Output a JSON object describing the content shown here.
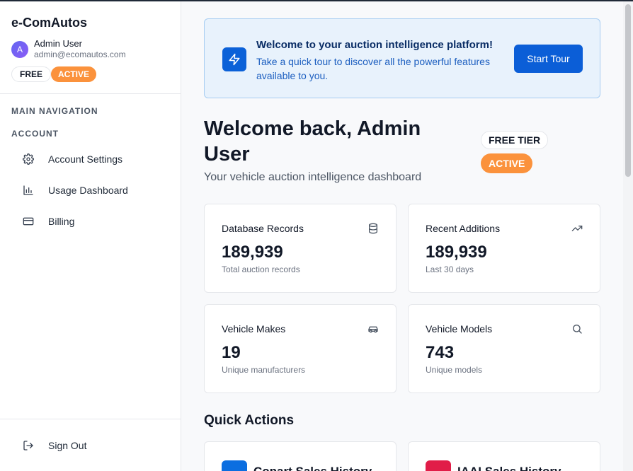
{
  "sidebar": {
    "brand": "e-ComAutos",
    "user": {
      "initial": "A",
      "name": "Admin User",
      "email": "admin@ecomautos.com"
    },
    "plan_badge": "FREE",
    "status_badge": "ACTIVE",
    "section_main": "MAIN NAVIGATION",
    "section_account": "ACCOUNT",
    "items": [
      {
        "label": "Account Settings",
        "icon": "gear-icon"
      },
      {
        "label": "Usage Dashboard",
        "icon": "bar-chart-icon"
      },
      {
        "label": "Billing",
        "icon": "credit-card-icon"
      }
    ],
    "sign_out": "Sign Out"
  },
  "banner": {
    "title": "Welcome to your auction intelligence platform!",
    "text": "Take a quick tour to discover all the powerful features available to you.",
    "button": "Start Tour",
    "icon": "lightning-icon"
  },
  "header": {
    "title": "Welcome back, Admin User",
    "subtitle": "Your vehicle auction intelligence dashboard",
    "tier": "FREE TIER",
    "status": "ACTIVE"
  },
  "stats": [
    {
      "label": "Database Records",
      "value": "189,939",
      "note": "Total auction records",
      "icon": "database-icon"
    },
    {
      "label": "Recent Additions",
      "value": "189,939",
      "note": "Last 30 days",
      "icon": "trending-up-icon"
    },
    {
      "label": "Vehicle Makes",
      "value": "19",
      "note": "Unique manufacturers",
      "icon": "car-icon"
    },
    {
      "label": "Vehicle Models",
      "value": "743",
      "note": "Unique models",
      "icon": "search-icon"
    }
  ],
  "quick_actions": {
    "title": "Quick Actions",
    "items": [
      {
        "label": "Copart Sales History",
        "color": "#0b6ee0"
      },
      {
        "label": "IAAI Sales History",
        "color": "#e11d48"
      }
    ]
  },
  "colors": {
    "accent": "#0b5ed7",
    "active_badge": "#fb923c",
    "banner_bg": "#e8f2fc"
  }
}
